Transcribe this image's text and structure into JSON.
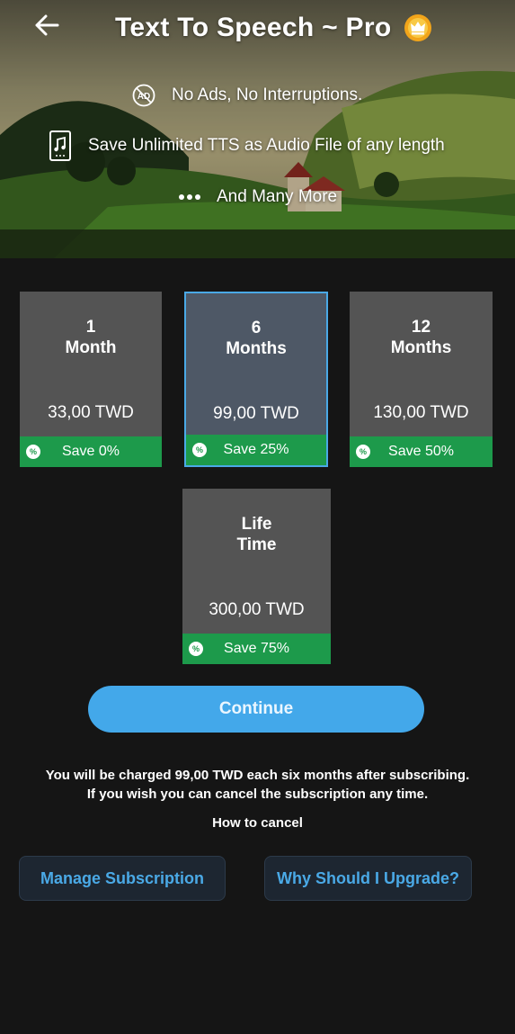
{
  "header": {
    "title": "Text To Speech ~ Pro",
    "features": [
      {
        "icon": "no-ads-icon",
        "text": "No Ads, No Interruptions."
      },
      {
        "icon": "audio-file-icon",
        "text": "Save Unlimited TTS as Audio File of any length"
      },
      {
        "icon": "more-dots-icon",
        "text": "And Many More"
      }
    ]
  },
  "plans": [
    {
      "line1": "1",
      "line2": "Month",
      "price": "33,00 TWD",
      "save": "Save 0%",
      "selected": false
    },
    {
      "line1": "6",
      "line2": "Months",
      "price": "99,00 TWD",
      "save": "Save 25%",
      "selected": true
    },
    {
      "line1": "12",
      "line2": "Months",
      "price": "130,00 TWD",
      "save": "Save 50%",
      "selected": false
    },
    {
      "line1": "Life",
      "line2": "Time",
      "price": "300,00 TWD",
      "save": "Save 75%",
      "selected": false
    }
  ],
  "percent_symbol": "%",
  "continue_label": "Continue",
  "charge_note": {
    "line1": "You will be charged 99,00 TWD each six months after subscribing.",
    "line2": "If you wish you can cancel the subscription any time."
  },
  "how_to_cancel": "How to cancel",
  "manage_subscription": "Manage Subscription",
  "why_upgrade": "Why Should I Upgrade?",
  "colors": {
    "accent": "#43a8ea",
    "save_green": "#1d9a4b",
    "background": "#151515",
    "card": "#545454",
    "card_selected": "#4e5866"
  }
}
